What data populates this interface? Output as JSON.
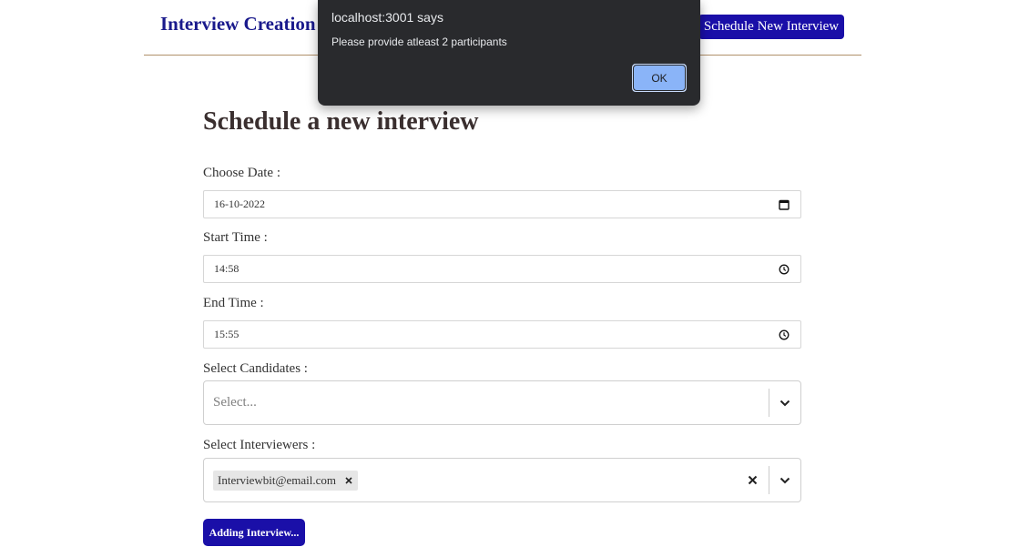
{
  "header": {
    "brand": "Interview Creation",
    "nav_button": "Schedule New Interview"
  },
  "form": {
    "title": "Schedule a new interview",
    "date": {
      "label": "Choose Date :",
      "value": "16-10-2022",
      "icon": "calendar-icon"
    },
    "start_time": {
      "label": "Start Time :",
      "value": "14:58",
      "icon": "clock-icon"
    },
    "end_time": {
      "label": "End Time :",
      "value": "15:55",
      "icon": "clock-icon"
    },
    "candidates": {
      "label": "Select Candidates :",
      "placeholder": "Select...",
      "icon": "chevron-down-icon"
    },
    "interviewers": {
      "label": "Select Interviewers :",
      "selected": [
        "Interviewbit@email.com"
      ],
      "icons": [
        "close-icon",
        "chevron-down-icon"
      ]
    },
    "submit_button": "Adding Interview..."
  },
  "dialog": {
    "title": "localhost:3001 says",
    "message": "Please provide atleast 2 participants",
    "ok_button": "OK"
  },
  "colors": {
    "brand": "#1a1a8c",
    "primary_button": "#1a0fa8",
    "header_rule": "#b0906a",
    "dialog_bg": "#292a2d",
    "dialog_ok": "#8ab4f8"
  }
}
